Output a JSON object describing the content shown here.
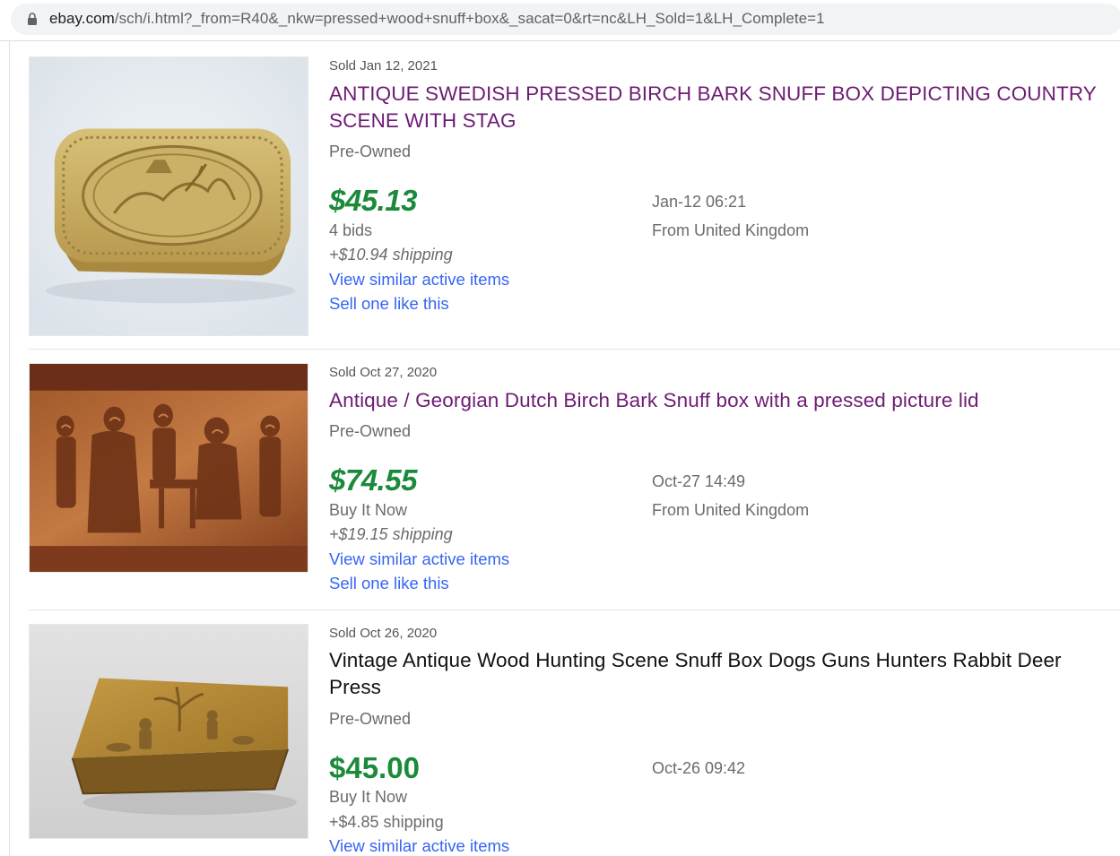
{
  "browser": {
    "url_host": "ebay.com",
    "url_path": "/sch/i.html?_from=R40&_nkw=pressed+wood+snuff+box&_sacat=0&rt=nc&LH_Sold=1&LH_Complete=1",
    "lock_icon": "lock-icon"
  },
  "listings": [
    {
      "sold_date": "Sold Jan 12, 2021",
      "title": "ANTIQUE SWEDISH PRESSED BIRCH BARK SNUFF BOX DEPICTING COUNTRY SCENE WITH STAG",
      "condition": "Pre-Owned",
      "price": "$45.13",
      "format": "4 bids",
      "shipping": "+$10.94 shipping",
      "view_similar": "View similar active items",
      "sell_one": "Sell one like this",
      "end_time": "Jan-12 06:21",
      "location": "From United Kingdom",
      "image": "snuff-box-stag-photo"
    },
    {
      "sold_date": "Sold Oct 27, 2020",
      "title": "Antique / Georgian Dutch Birch Bark Snuff box with a pressed picture lid",
      "condition": "Pre-Owned",
      "price": "$74.55",
      "format": "Buy It Now",
      "shipping": "+$19.15 shipping",
      "view_similar": "View similar active items",
      "sell_one": "Sell one like this",
      "end_time": "Oct-27 14:49",
      "location": "From United Kingdom",
      "image": "snuff-box-tavern-photo"
    },
    {
      "sold_date": "Sold Oct 26, 2020",
      "title": "Vintage Antique Wood Hunting Scene Snuff Box Dogs Guns Hunters Rabbit Deer Press",
      "condition": "Pre-Owned",
      "price": "$45.00",
      "format": "Buy It Now",
      "shipping": "+$4.85 shipping",
      "view_similar": "View similar active items",
      "end_time": "Oct-26 09:42",
      "image": "snuff-box-hunting-photo"
    }
  ],
  "colors": {
    "title_visited": "#6e1c74",
    "title_unvisited": "#111111",
    "price_green": "#1b8a3b",
    "link_blue": "#3665f3"
  }
}
